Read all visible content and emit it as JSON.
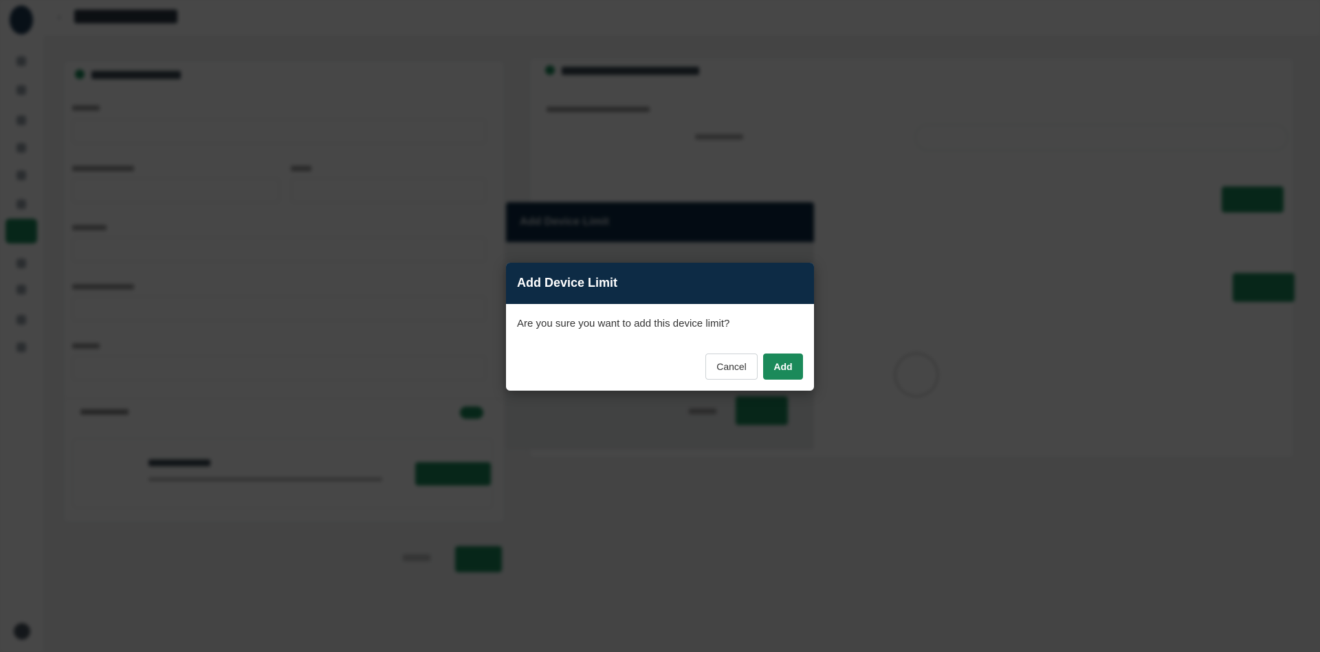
{
  "dialog": {
    "title": "Add Device Limit",
    "message": "Are you sure you want to add this device limit?",
    "cancel_label": "Cancel",
    "add_label": "Add"
  },
  "colors": {
    "header": "#0d2b45",
    "primary": "#1b8a5a",
    "overlay": "rgba(0,0,0,0.72)"
  }
}
